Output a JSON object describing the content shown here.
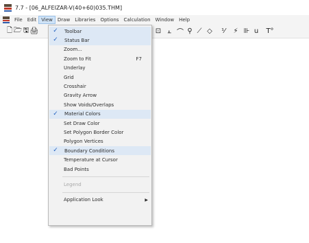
{
  "title": "7.7 - [06_ALFEIZAR-V(40+60)035.THM]",
  "menubar": [
    "File",
    "Edit",
    "View",
    "Draw",
    "Libraries",
    "Options",
    "Calculation",
    "Window",
    "Help"
  ],
  "view_menu": [
    {
      "label": "Toolbar",
      "checked": true
    },
    {
      "label": "Status Bar",
      "checked": true
    },
    {
      "label": "Zoom...",
      "checked": false
    },
    {
      "label": "Zoom to Fit",
      "shortcut": "F7",
      "checked": false
    },
    {
      "label": "Underlay",
      "checked": false
    },
    {
      "label": "Grid",
      "checked": false
    },
    {
      "label": "Crosshair",
      "checked": false
    },
    {
      "label": "Gravity Arrow",
      "checked": false
    },
    {
      "label": "Show Voids/Overlaps",
      "checked": false
    },
    {
      "label": "Material Colors",
      "checked": true
    },
    {
      "label": "Set Draw Color",
      "checked": false
    },
    {
      "label": "Set Polygon Border Color",
      "checked": false
    },
    {
      "label": "Polygon Vertices",
      "checked": false
    },
    {
      "label": "Boundary Conditions",
      "checked": true
    },
    {
      "label": "Temperature at Cursor",
      "checked": false
    },
    {
      "label": "Bad Points",
      "checked": false
    },
    {
      "label": "Legend",
      "checked": false,
      "disabled": true
    },
    {
      "label": "Application Look",
      "checked": false,
      "submenu": true
    }
  ],
  "toolbar_icons": [
    "new-file-icon",
    "open-folder-icon",
    "save-icon",
    "print-icon",
    "insert-icon",
    "boundary-icon",
    "arc-icon",
    "zoom-icon",
    "pencil-icon",
    "diamond-icon",
    "fraction-icon",
    "lightning-icon",
    "rule-icon",
    "u-factor-icon",
    "temperature-icon"
  ],
  "toolbar_glyphs": [
    "🗋",
    "🗁",
    "🖫",
    "🖨",
    "⊡",
    "⫠",
    "⌒",
    "⚲",
    "⟋",
    "◇",
    "⅟",
    "⚡",
    "⊪",
    "u",
    "T°"
  ]
}
